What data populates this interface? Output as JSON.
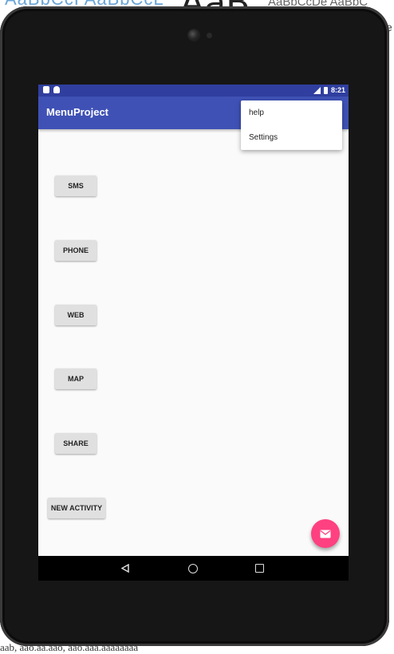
{
  "background": {
    "top_text": "AaBbCcI AaBbCcL",
    "big_text": "AaB",
    "right_text": "AaBbCcDe AaBbC",
    "edge_letter": "e",
    "bottom_text": "aab, aao.aa.aao, aao.aaa.aaaaaaaa"
  },
  "status_bar": {
    "time": "8:21"
  },
  "app": {
    "title": "MenuProject"
  },
  "buttons": {
    "sms": "SMS",
    "phone": "PHONE",
    "web": "WEB",
    "map": "MAP",
    "share": "SHARE",
    "new_activity": "NEW ACTIVITY"
  },
  "menu": {
    "items": [
      "help",
      "Settings"
    ]
  },
  "colors": {
    "primary": "#3f51b5",
    "primary_dark": "#303f9f",
    "accent": "#ff4081",
    "button": "#e0e0e0",
    "background": "#fafafa"
  },
  "icons": {
    "fab": "email-icon",
    "nav_back": "back-triangle-icon",
    "nav_home": "home-circle-icon",
    "nav_recent": "recents-square-icon"
  }
}
